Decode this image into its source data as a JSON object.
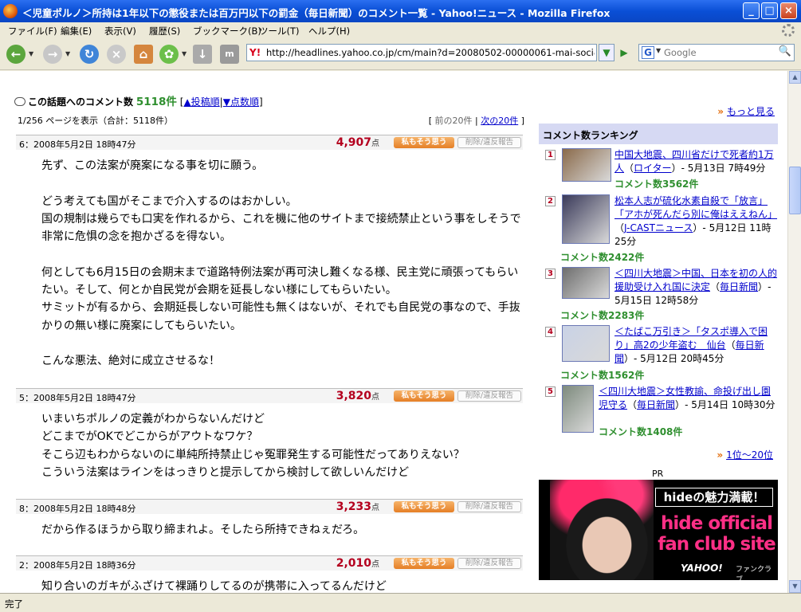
{
  "window": {
    "title": "＜児童ポルノ＞所持は1年以下の懲役または百万円以下の罰金（毎日新聞）のコメント一覧 - Yahoo!ニュース - Mozilla Firefox",
    "min_label": "_",
    "max_label": "□",
    "close_label": "×"
  },
  "menu": [
    "ファイル(F)",
    "編集(E)",
    "表示(V)",
    "履歴(S)",
    "ブックマーク(B)",
    "ツール(T)",
    "ヘルプ(H)"
  ],
  "toolbar": {
    "url": "http://headlines.yahoo.co.jp/cm/main?d=20080502-00000061-mai-soci&s=points",
    "search_placeholder": "Google",
    "go_label": "▶",
    "icons": [
      "back-icon",
      "forward-icon",
      "reload-icon",
      "stop-icon",
      "home-icon",
      "greasemonkey-icon",
      "download-icon",
      "mm-icon",
      "search-icon"
    ]
  },
  "comments_header": {
    "label": "この話題へのコメント数",
    "count": "5118件",
    "bracket_open": "[",
    "sort_post": "▲投稿順",
    "sep": "|",
    "sort_points": "▼点数順",
    "bracket_close": "]",
    "page_info": "1/256 ページを表示（合計：5118件）",
    "prev": "前の20件",
    "next": "次の20件",
    "nav_open": "[",
    "nav_sep": "|",
    "nav_close": "]"
  },
  "buttons": {
    "agree": "私もそう思う",
    "report": "削除/違反報告"
  },
  "points_unit": "点",
  "comments": [
    {
      "meta": "6：2008年5月2日 18時47分",
      "points": "4,907",
      "body": "先ず、この法案が廃案になる事を切に願う。\n\nどう考えても国がそこまで介入するのはおかしい。\n国の規制は幾らでも口実を作れるから、これを機に他のサイトまで接続禁止という事をしそうで非常に危惧の念を抱かざるを得ない。\n\n何としても6月15日の会期末まで道路特例法案が再可決し難くなる様、民主党に頑張ってもらいたい。そして、何とか自民党が会期を延長しない様にしてもらいたい。\nサミットが有るから、会期延長しない可能性も無くはないが、それでも自民党の事なので、手抜かりの無い様に廃案にしてもらいたい。\n\nこんな悪法、絶対に成立させるな！"
    },
    {
      "meta": "5：2008年5月2日 18時47分",
      "points": "3,820",
      "body": "いまいちポルノの定義がわからないんだけど\nどこまでがOKでどこからがアウトなワケ？\nそこら辺もわからないのに単純所持禁止じゃ冤罪発生する可能性だってありえない？\nこういう法案はラインをはっきりと提示してから検討して欲しいんだけど"
    },
    {
      "meta": "8：2008年5月2日 18時48分",
      "points": "3,233",
      "body": "だから作るほうから取り締まれよ。そしたら所持できねぇだろ。"
    },
    {
      "meta": "2：2008年5月2日 18時36分",
      "points": "2,010",
      "body": "知り合いのガキがふざけて裸踊りしてるのが携帯に入ってるんだけど"
    }
  ],
  "sidebar": {
    "more": "もっと見る",
    "ranking_title": "コメント数ランキング",
    "ranking": [
      {
        "rank": "1",
        "headline": "中国大地震、四川省だけで死者約1万人",
        "source": "ロイター",
        "date": "- 5月13日 7時49分",
        "count": "コメント数3562件"
      },
      {
        "rank": "2",
        "headline": "松本人志が硫化水素自殺で「放言」「アホが死んだら別に俺はええねん」",
        "source": "J-CASTニュース",
        "date": "- 5月12日 11時25分",
        "count": "コメント数2422件"
      },
      {
        "rank": "3",
        "headline": "＜四川大地震＞中国、日本を初の人的援助受け入れ国に決定",
        "source": "毎日新聞",
        "date": "- 5月15日 12時58分",
        "count": "コメント数2283件"
      },
      {
        "rank": "4",
        "headline": "＜たばこ万引き＞「タスポ導入で困り」高2の少年盗む　仙台",
        "source": "毎日新聞",
        "date": "- 5月12日 20時45分",
        "count": "コメント数1562件"
      },
      {
        "rank": "5",
        "headline": "＜四川大地震＞女性教諭、命投げ出し園児守る",
        "source": "毎日新聞",
        "date": "- 5月14日 10時30分",
        "count": "コメント数1408件"
      }
    ],
    "page_link": "1位〜20位",
    "pr": "PR",
    "ad": {
      "tag": "hideの魅力満載！",
      "line1": "hide official",
      "line2": "fan club site",
      "brand": "YAHOO!",
      "brand_sub": "JAPAN",
      "fanclub": "ファンクラブ"
    },
    "thumb_colors": [
      "#8a6a4a",
      "#3a3a5a",
      "#6e6e6e",
      "#c9d2e6",
      "#7d8a7d"
    ]
  },
  "status": "完了"
}
